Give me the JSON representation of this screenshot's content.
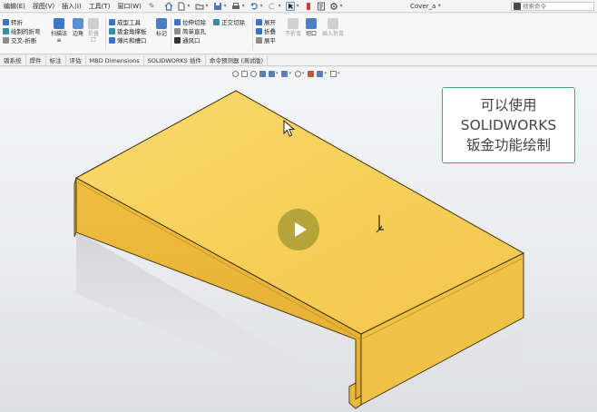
{
  "menubar": {
    "items": [
      "编辑(E)",
      "视图(V)",
      "插入(I)",
      "工具(T)",
      "窗口(W)"
    ],
    "document_title": "Cover_a *",
    "search_placeholder": "搜索命令"
  },
  "ribbon": {
    "col1": [
      "转折",
      "绘制的折弯",
      "交叉-折断"
    ],
    "col2_buttons": [
      {
        "label": "扫描法",
        "icon": "sweep-icon",
        "enabled": true
      },
      {
        "label": "边角",
        "icon": "corner-icon",
        "enabled": true
      },
      {
        "label": "折叠",
        "icon": "fold-icon",
        "enabled": false
      },
      {
        "label": "口",
        "icon": "",
        "enabled": false
      }
    ],
    "col3": [
      "成型工具",
      "钣金角撑板",
      "薄片和槽口"
    ],
    "col4_button": {
      "label": "标记",
      "icon": "stamp-icon"
    },
    "col5": [
      "拉伸切除",
      "简单直孔",
      "通风口"
    ],
    "col6": [
      "正交切除"
    ],
    "col7": [
      "展开",
      "折叠",
      "展平"
    ],
    "col8_buttons": [
      {
        "label": "不折弯",
        "enabled": false
      },
      {
        "label": "切口",
        "enabled": true
      },
      {
        "label": "插入折弯",
        "enabled": false
      }
    ]
  },
  "tabs": [
    "钣系统",
    "焊件",
    "标注",
    "评估",
    "MBD Dimensions",
    "SOLIDWORKS 插件",
    "命令预测器 (测试版)"
  ],
  "callout": {
    "line1": "可以使用",
    "line2": "SOLIDWORKS",
    "line3": "钣金功能绘制"
  },
  "colors": {
    "accent_green": "#3ea57e",
    "sheet_metal_yellow": "#f5c84c",
    "play_button": "#afa037"
  }
}
